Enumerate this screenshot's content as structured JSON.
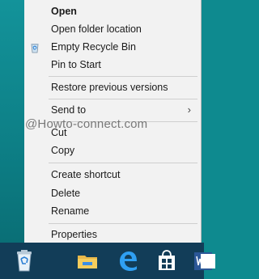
{
  "menu": {
    "items": [
      {
        "label": "Open",
        "bold": true
      },
      {
        "label": "Open folder location"
      },
      {
        "label": "Empty Recycle Bin",
        "icon": "recycle-bin-icon"
      },
      {
        "label": "Pin to Start"
      },
      {
        "label": "Restore previous versions"
      },
      {
        "label": "Send to",
        "submenu": true
      },
      {
        "label": "Cut"
      },
      {
        "label": "Copy"
      },
      {
        "label": "Create shortcut"
      },
      {
        "label": "Delete"
      },
      {
        "label": "Rename"
      },
      {
        "label": "Properties"
      }
    ],
    "submenu_arrow": "›"
  },
  "watermark": "@Howto-connect.com",
  "taskbar": {
    "icons": [
      "recycle-bin-icon",
      "file-explorer-icon",
      "edge-icon",
      "store-icon",
      "word-icon"
    ]
  },
  "colors": {
    "desktop": "#0e8a8f",
    "menu_bg": "#f2f2f2",
    "taskbar": "#123d58",
    "accent": "#1e6fd9"
  }
}
